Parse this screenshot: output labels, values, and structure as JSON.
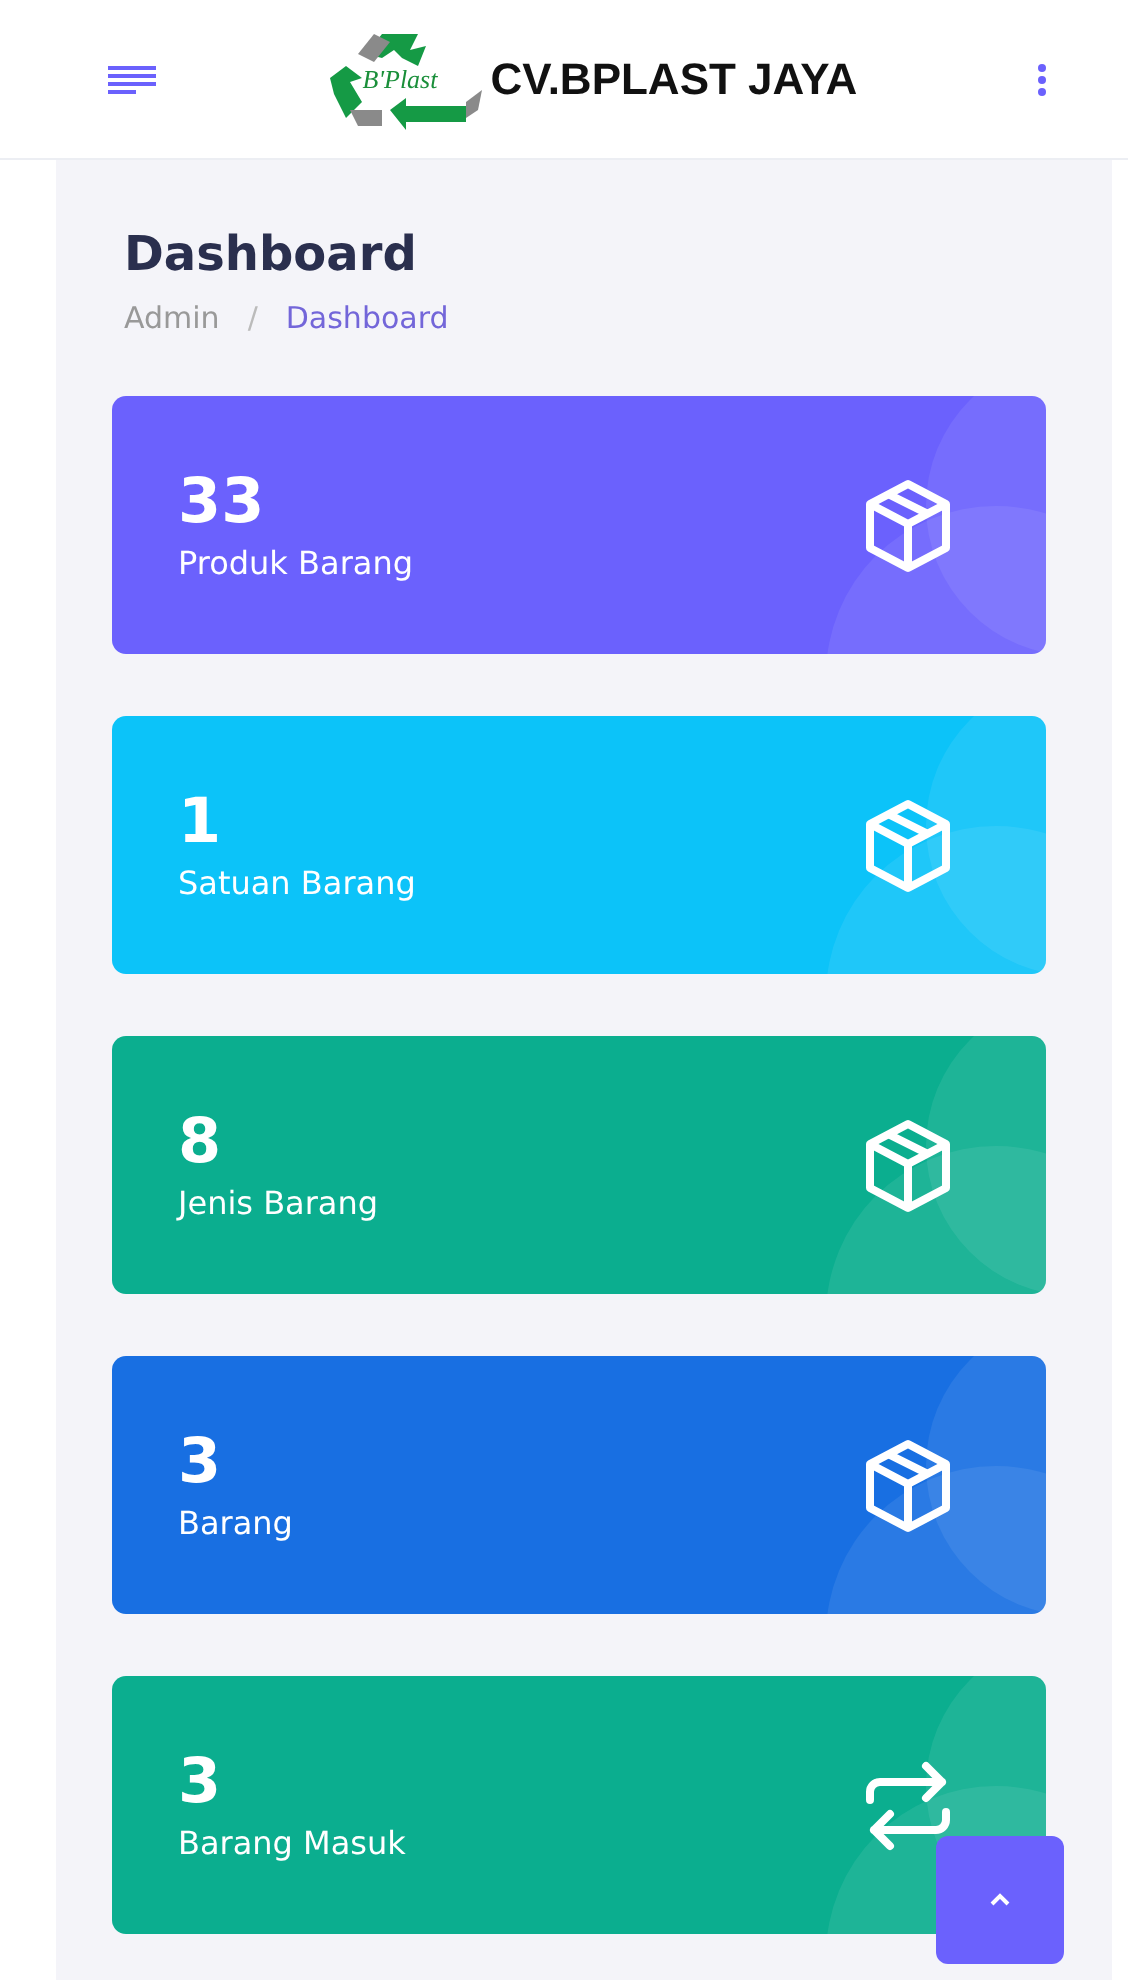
{
  "header": {
    "logo_text": "B'Plast",
    "brand": "CV.BPLAST JAYA"
  },
  "page": {
    "title": "Dashboard",
    "separator": "/",
    "breadcrumb": [
      {
        "label": "Admin",
        "selected": false
      },
      {
        "label": "Dashboard",
        "selected": true
      }
    ]
  },
  "cards": [
    {
      "value": "33",
      "label": "Produk Barang",
      "kind": "box",
      "color": "#6b61fd"
    },
    {
      "value": "1",
      "label": "Satuan Barang",
      "kind": "box",
      "color": "#0cc3f9"
    },
    {
      "value": "8",
      "label": "Jenis Barang",
      "kind": "box",
      "color": "#0bae8f"
    },
    {
      "value": "3",
      "label": "Barang",
      "kind": "box",
      "color": "#186fe2"
    },
    {
      "value": "3",
      "label": "Barang Masuk",
      "kind": "transfer",
      "color": "#0bae8f"
    }
  ]
}
